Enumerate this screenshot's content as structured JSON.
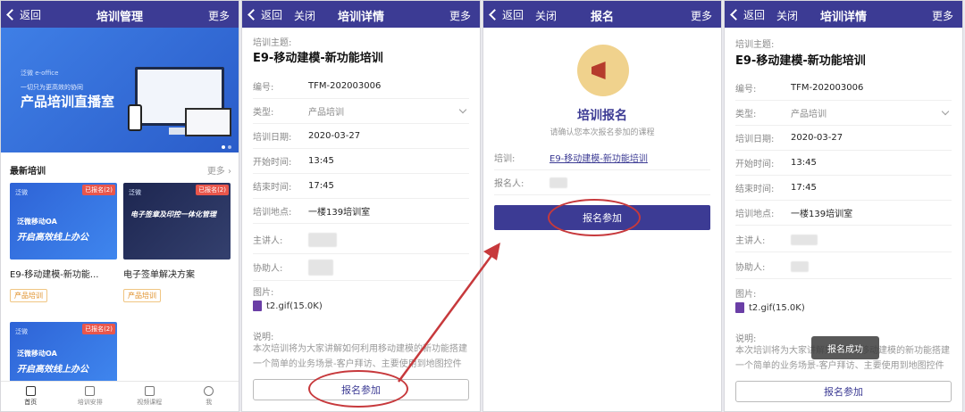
{
  "colors": {
    "primary": "#3c3b94",
    "annotation": "#c7393c",
    "badge": "#e9564b",
    "tag": "#e0912b"
  },
  "p1": {
    "nav": {
      "back": "返回",
      "title": "培训管理",
      "more": "更多"
    },
    "banner": {
      "brand": "泛微 e-office",
      "slogan": "一切只为更高效的协同",
      "headline": "产品培训直播室"
    },
    "section": {
      "title": "最新培训",
      "more": "更多"
    },
    "cards": [
      {
        "badge": "已报名(2)",
        "logo": "泛微",
        "thumb_title": "泛微移动OA",
        "thumb_slogan": "开启高效线上办公",
        "title": "E9-移动建模-新功能...",
        "tag": "产品培训"
      },
      {
        "badge": "已报名(2)",
        "logo": "泛微",
        "thumb_title": "电子签章及印控一体化管理",
        "thumb_slogan": "",
        "title": "电子签单解决方案",
        "tag": "产品培训"
      },
      {
        "badge": "已报名(2)",
        "logo": "泛微",
        "thumb_title": "泛微移动OA",
        "thumb_slogan": "开启高效线上办公"
      }
    ],
    "tabs": [
      {
        "label": "首页",
        "icon": "home-icon"
      },
      {
        "label": "培训安排",
        "icon": "schedule-icon"
      },
      {
        "label": "视频课程",
        "icon": "video-icon"
      },
      {
        "label": "我",
        "icon": "person-icon"
      }
    ]
  },
  "p2": {
    "nav": {
      "back": "返回",
      "close": "关闭",
      "title": "培训详情",
      "more": "更多"
    },
    "topic_label": "培训主题:",
    "topic": "E9-移动建模-新功能培训",
    "fields": [
      {
        "label": "编号:",
        "value": "TFM-202003006"
      },
      {
        "label": "类型:",
        "value": "产品培训"
      },
      {
        "label": "培训日期:",
        "value": "2020-03-27"
      },
      {
        "label": "开始时间:",
        "value": "13:45"
      },
      {
        "label": "结束时间:",
        "value": "17:45"
      },
      {
        "label": "培训地点:",
        "value": "一楼139培训室"
      },
      {
        "label": "主讲人:",
        "value": ""
      },
      {
        "label": "协助人:",
        "value": ""
      }
    ],
    "image_label": "图片:",
    "file": "t2.gif(15.0K)",
    "desc_label": "说明:",
    "desc": "本次培训将为大家讲解如何利用移动建模的新功能搭建一个简单的业务场景-客户拜访、主要使用到地图控件存",
    "register_btn": "报名参加"
  },
  "p3": {
    "nav": {
      "back": "返回",
      "close": "关闭",
      "title": "报名",
      "more": "更多"
    },
    "icon": "megaphone-icon",
    "title": "培训报名",
    "subtitle": "请确认您本次报名参加的课程",
    "training_label": "培训:",
    "training_link": "E9-移动建模-新功能培训",
    "registrant_label": "报名人:",
    "submit_btn": "报名参加"
  },
  "p4": {
    "nav": {
      "back": "返回",
      "close": "关闭",
      "title": "培训详情",
      "more": "更多"
    },
    "topic_label": "培训主题:",
    "topic": "E9-移动建模-新功能培训",
    "fields": [
      {
        "label": "编号:",
        "value": "TFM-202003006"
      },
      {
        "label": "类型:",
        "value": "产品培训"
      },
      {
        "label": "培训日期:",
        "value": "2020-03-27"
      },
      {
        "label": "开始时间:",
        "value": "13:45"
      },
      {
        "label": "结束时间:",
        "value": "17:45"
      },
      {
        "label": "培训地点:",
        "value": "一楼139培训室"
      },
      {
        "label": "主讲人:",
        "value": ""
      },
      {
        "label": "协助人:",
        "value": ""
      }
    ],
    "image_label": "图片:",
    "file": "t2.gif(15.0K)",
    "desc_label": "说明:",
    "desc": "本次培训将为大家讲解如何利用移动建模的新功能搭建一个简单的业务场景-客户拜访、主要使用到地图控件存",
    "toast": "报名成功",
    "register_btn": "报名参加"
  }
}
